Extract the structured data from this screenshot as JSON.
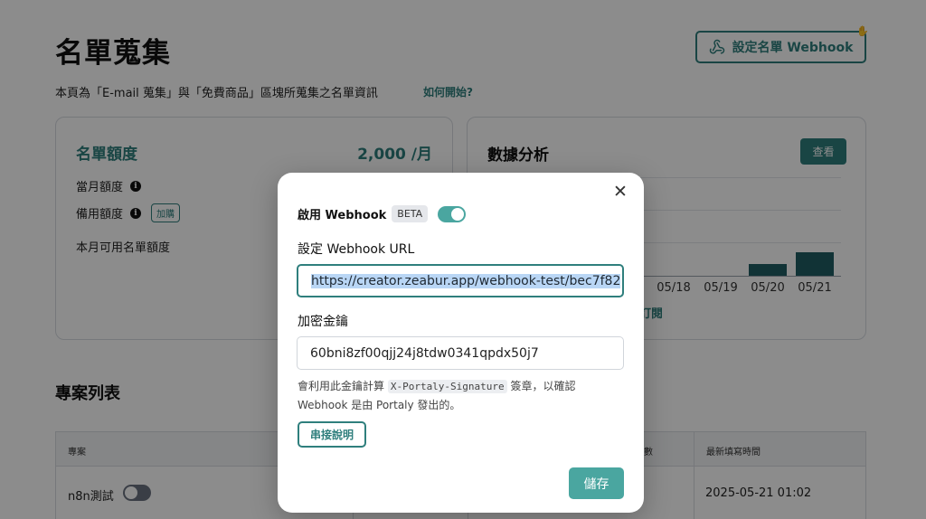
{
  "header": {
    "title": "名單蒐集",
    "webhook_button": "設定名單 Webhook",
    "intro": "本頁為「E-mail 蒐集」與「免費商品」區塊所蒐集之名單資訊",
    "how_link": "如何開始?"
  },
  "quota_card": {
    "title": "名單額度",
    "value": "2,000 /月",
    "monthly_label": "當月額度",
    "backup_label": "備用額度",
    "buy_label": "加購",
    "available_label": "本月可用名單額度"
  },
  "analysis_card": {
    "title": "數據分析",
    "view_button": "查看",
    "sub_link": "訂閱"
  },
  "chart_data": {
    "type": "bar",
    "categories": [
      "05/18",
      "05/19",
      "05/20",
      "05/21"
    ],
    "values": [
      0,
      0,
      1,
      2
    ],
    "title": "",
    "xlabel": "",
    "ylabel": ""
  },
  "projects": {
    "title": "專案列表",
    "headers": {
      "project": "專案",
      "count": "數",
      "last_filled": "最新填寫時間"
    },
    "rows": [
      {
        "name": "n8n測試",
        "last_filled": "2025-05-21 01:02"
      }
    ]
  },
  "modal": {
    "enable_label": "啟用 Webhook",
    "beta_badge": "BETA",
    "enabled": true,
    "url_label": "設定 Webhook URL",
    "url_value": "https://creator.zeabur.app/webhook-test/bec7f82",
    "secret_label": "加密金鑰",
    "secret_value": "60bni8zf00qjj24j8tdw0341qpdx50j7",
    "hint_prefix": "會利用此金鑰計算 ",
    "hint_code": "X-Portaly-Signature",
    "hint_suffix": " 簽章，以確認 Webhook 是由 Portaly 發出的。",
    "doc_button": "串接說明",
    "save_button": "儲存"
  },
  "colors": {
    "accent": "#2f7f7d",
    "accent_light": "#4aa6a0",
    "bar": "#1f5e63"
  }
}
